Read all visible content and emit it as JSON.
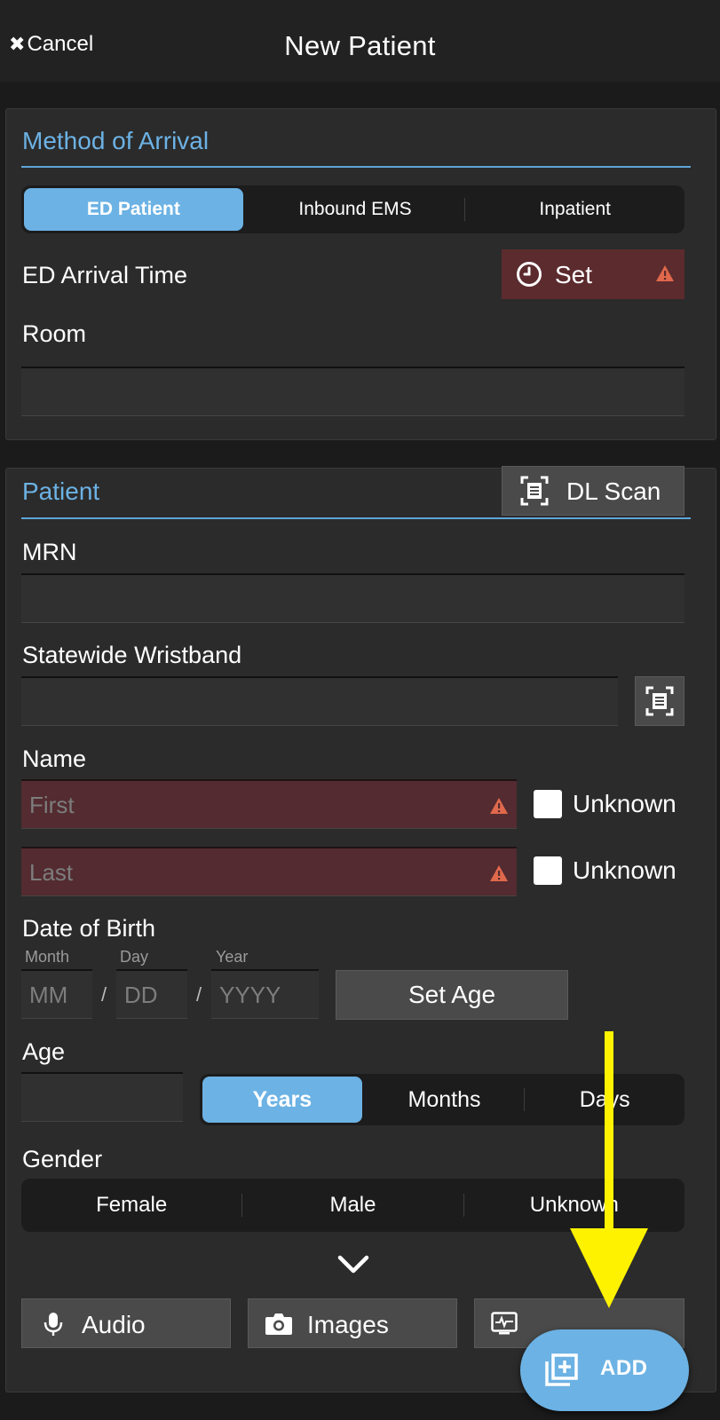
{
  "header": {
    "cancel_label": "Cancel",
    "title": "New Patient"
  },
  "arrival": {
    "section_title": "Method of Arrival",
    "method_options": [
      "ED Patient",
      "Inbound EMS",
      "Inpatient"
    ],
    "method_selected": "ED Patient",
    "arrival_time_label": "ED Arrival Time",
    "set_label": "Set",
    "room_label": "Room",
    "room_value": ""
  },
  "patient": {
    "section_title": "Patient",
    "dl_scan_label": "DL Scan",
    "mrn_label": "MRN",
    "mrn_value": "",
    "wristband_label": "Statewide Wristband",
    "wristband_value": "",
    "name_label": "Name",
    "first_placeholder": "First",
    "last_placeholder": "Last",
    "unknown_label": "Unknown",
    "first_unknown_checked": false,
    "last_unknown_checked": false,
    "dob_label": "Date of Birth",
    "month_label": "Month",
    "day_label": "Day",
    "year_label": "Year",
    "month_placeholder": "MM",
    "day_placeholder": "DD",
    "year_placeholder": "YYYY",
    "slash": "/",
    "set_age_label": "Set Age",
    "age_label": "Age",
    "age_value": "",
    "age_units": [
      "Years",
      "Months",
      "Days"
    ],
    "age_unit_selected": "Years",
    "gender_label": "Gender",
    "gender_options": [
      "Female",
      "Male",
      "Unknown"
    ],
    "gender_selected": ""
  },
  "actions": {
    "audio_label": "Audio",
    "images_label": "Images",
    "add_label": "ADD"
  },
  "icons": [
    "close-icon",
    "clock-icon",
    "warning-icon",
    "scan-icon",
    "chevron-down-icon",
    "microphone-icon",
    "camera-icon",
    "vitals-icon",
    "add-copy-icon"
  ],
  "colors": {
    "accent": "#6cb2e4",
    "error_background": "#532b30",
    "warning": "#e0684b",
    "annotation_arrow": "#fff200"
  }
}
